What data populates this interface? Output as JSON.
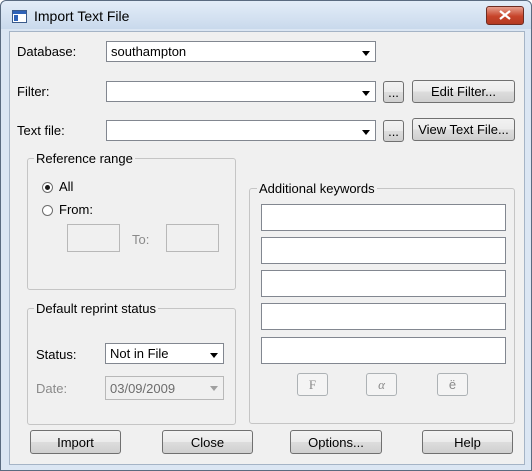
{
  "window": {
    "title": "Import Text File"
  },
  "database": {
    "label": "Database:",
    "value": "southampton"
  },
  "filter": {
    "label": "Filter:",
    "value": "",
    "browse": "...",
    "edit_button": "Edit Filter..."
  },
  "text_file": {
    "label": "Text file:",
    "value": "",
    "browse": "...",
    "view_button": "View Text File..."
  },
  "reference_range": {
    "legend": "Reference range",
    "all_label": "All",
    "from_label": "From:",
    "to_label": "To:",
    "selected": "All",
    "from_value": "",
    "to_value": ""
  },
  "default_reprint": {
    "legend": "Default reprint status",
    "status_label": "Status:",
    "status_value": "Not in File",
    "date_label": "Date:",
    "date_value": "03/09/2009"
  },
  "keywords": {
    "legend": "Additional keywords",
    "values": [
      "",
      "",
      "",
      "",
      ""
    ],
    "symbols": [
      "F",
      "α",
      "ë"
    ]
  },
  "buttons": {
    "import": "Import",
    "close": "Close",
    "options": "Options...",
    "help": "Help"
  }
}
